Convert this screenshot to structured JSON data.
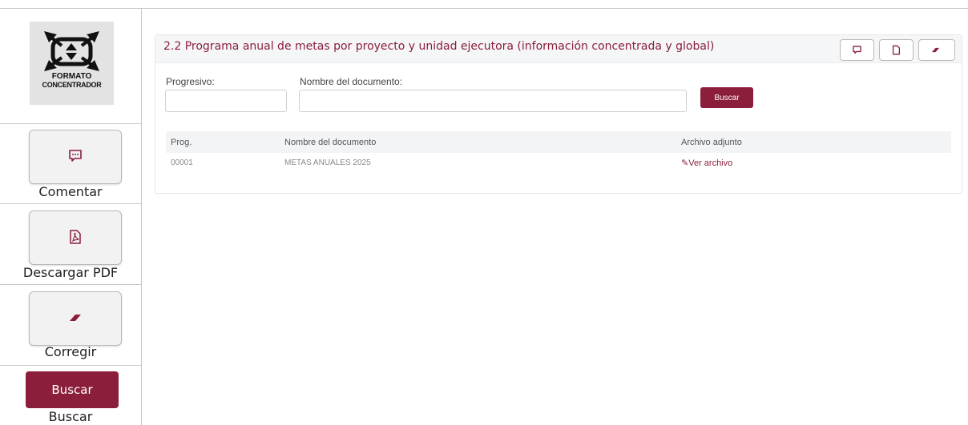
{
  "sidebar": {
    "logo_line1": "FORMATO",
    "logo_line2": "CONCENTRADOR",
    "comentar_label": "Comentar",
    "pdf_label": "Descargar PDF",
    "corregir_label": "Corregir",
    "buscar_button": "Buscar",
    "buscar_label": "Buscar",
    "icons": [
      "comment-icon",
      "pdf-icon",
      "eraser-icon"
    ]
  },
  "panel": {
    "title": "2.2 Programa anual de metas por proyecto y unidad ejecutora (información concentrada y global)",
    "header_icons": [
      "comment-icon",
      "pdf-icon",
      "eraser-icon"
    ]
  },
  "search": {
    "progresivo_label": "Progresivo:",
    "progresivo_value": "",
    "nombre_label": "Nombre del documento:",
    "nombre_value": "",
    "button": "Buscar"
  },
  "table": {
    "columns": [
      "Prog.",
      "Nombre del documento",
      "Archivo adjunto"
    ],
    "rows": [
      {
        "prog": "00001",
        "nombre": "METAS ANUALES 2025",
        "archivo": "Ver archivo",
        "archivo_icon": "paperclip-icon"
      }
    ]
  },
  "colors": {
    "accent": "#8b1e3a",
    "panel_header": "#f5f6f8",
    "border": "#c9c9c9"
  }
}
